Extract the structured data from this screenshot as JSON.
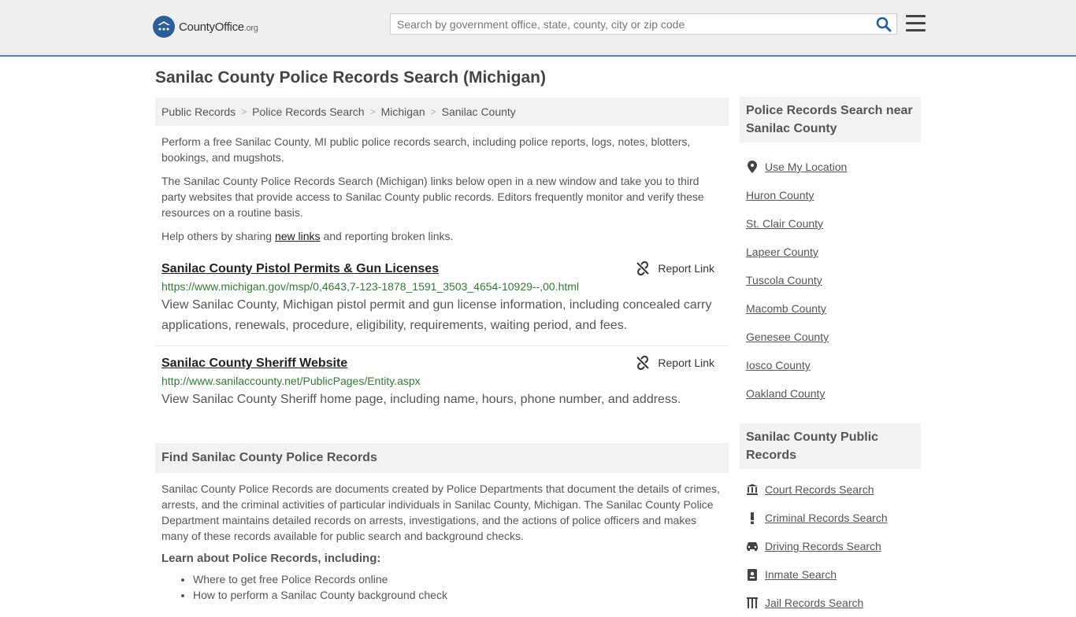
{
  "header": {
    "logo_text": "CountyOffice",
    "logo_tld": ".org",
    "search_placeholder": "Search by government office, state, county, city or zip code"
  },
  "page_title": "Sanilac County Police Records Search (Michigan)",
  "breadcrumb": [
    "Public Records",
    "Police Records Search",
    "Michigan",
    "Sanilac County"
  ],
  "intro": {
    "p1": "Perform a free Sanilac County, MI public police records search, including police reports, logs, notes, blotters, bookings, and mugshots.",
    "p2": "The Sanilac County Police Records Search (Michigan) links below open in a new window and take you to third party websites that provide access to Sanilac County public records. Editors frequently monitor and verify these resources on a routine basis.",
    "p3_before": "Help others by sharing ",
    "p3_link": "new links",
    "p3_after": " and reporting broken links."
  },
  "entries": [
    {
      "title": "Sanilac County Pistol Permits & Gun Licenses",
      "report": "Report Link",
      "url": "https://www.michigan.gov/msp/0,4643,7-123-1878_1591_3503_4654-10929--,00.html",
      "desc": "View Sanilac County, Michigan pistol permit and gun license information, including concealed carry applications, renewals, procedure, eligibility, requirements, waiting period, and fees."
    },
    {
      "title": "Sanilac County Sheriff Website",
      "report": "Report Link",
      "url": "http://www.sanilaccounty.net/PublicPages/Entity.aspx",
      "desc": "View Sanilac County Sheriff home page, including name, hours, phone number, and address."
    }
  ],
  "find_section": {
    "heading": "Find Sanilac County Police Records",
    "body": "Sanilac County Police Records are documents created by Police Departments that document the details of crimes, arrests, and the criminal activities of particular individuals in Sanilac County, Michigan. The Sanilac County Police Department maintains detailed records on arrests, investigations, and the actions of police officers and makes many of these records available for public search and background checks.",
    "learn_heading": "Learn about Police Records, including:",
    "learn_items": [
      "Where to get free Police Records online",
      "How to perform a Sanilac County background check"
    ]
  },
  "sidebar": {
    "near_heading": "Police Records Search near Sanilac County",
    "use_location": "Use My Location",
    "near_items": [
      "Huron County",
      "St. Clair County",
      "Lapeer County",
      "Tuscola County",
      "Macomb County",
      "Genesee County",
      "Iosco County",
      "Oakland County"
    ],
    "public_heading": "Sanilac County Public Records",
    "public_items": [
      {
        "label": "Court Records Search",
        "icon": "courthouse-icon"
      },
      {
        "label": "Criminal Records Search",
        "icon": "exclamation-icon"
      },
      {
        "label": "Driving Records Search",
        "icon": "car-icon"
      },
      {
        "label": "Inmate Search",
        "icon": "id-badge-icon"
      },
      {
        "label": "Jail Records Search",
        "icon": "jail-icon"
      }
    ]
  },
  "colors": {
    "accent_border": "#4a86c5",
    "url_green": "#2e7d32",
    "panel_bg": "#f2f2f2"
  }
}
